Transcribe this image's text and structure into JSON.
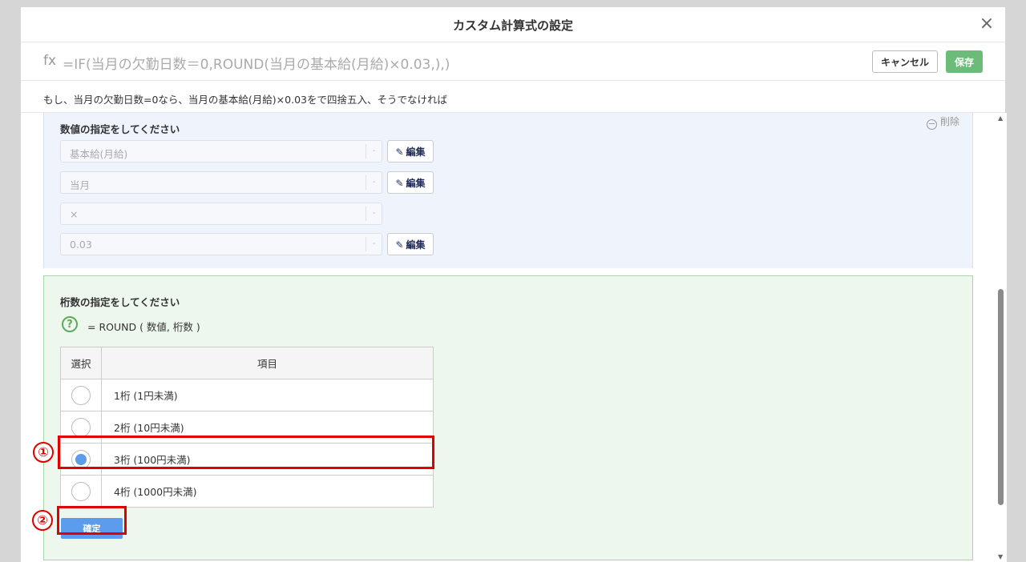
{
  "modal": {
    "title": "カスタム計算式の設定",
    "close_symbol": "×"
  },
  "formula_bar": {
    "fx_label": "fx",
    "formula": "=IF(当月の欠勤日数＝0,ROUND(当月の基本給(月給)×0.03,),)",
    "cancel_label": "キャンセル",
    "save_label": "保存"
  },
  "description": "もし、当月の欠勤日数=0なら、当月の基本給(月給)×0.03をで四捨五入、そうでなければ",
  "value_section": {
    "title": "数値の指定をしてください",
    "delete_label": "削除",
    "fields": [
      {
        "value": "基本給(月給)",
        "edit_label": "編集"
      },
      {
        "value": "当月",
        "edit_label": "編集"
      },
      {
        "value": "×"
      },
      {
        "value": "0.03",
        "edit_label": "編集"
      }
    ]
  },
  "digits_section": {
    "title": "桁数の指定をしてください",
    "help_symbol": "?",
    "hint": "= ROUND ( 数値, 桁数 )",
    "table": {
      "headers": [
        "選択",
        "項目"
      ],
      "rows": [
        {
          "label": "1桁 (1円未満)",
          "selected": false
        },
        {
          "label": "2桁 (10円未満)",
          "selected": false
        },
        {
          "label": "3桁 (100円未満)",
          "selected": true
        },
        {
          "label": "4桁 (1000円未満)",
          "selected": false
        }
      ]
    },
    "confirm_label": "確定"
  },
  "annotations": {
    "marker_1": "①",
    "marker_2": "②",
    "highlight_color": "#e10000"
  },
  "colors": {
    "save_green": "#6dbb78",
    "confirm_blue": "#5b9cec",
    "value_section_bg": "#eef3fc",
    "digits_section_bg": "#eef7ee"
  }
}
